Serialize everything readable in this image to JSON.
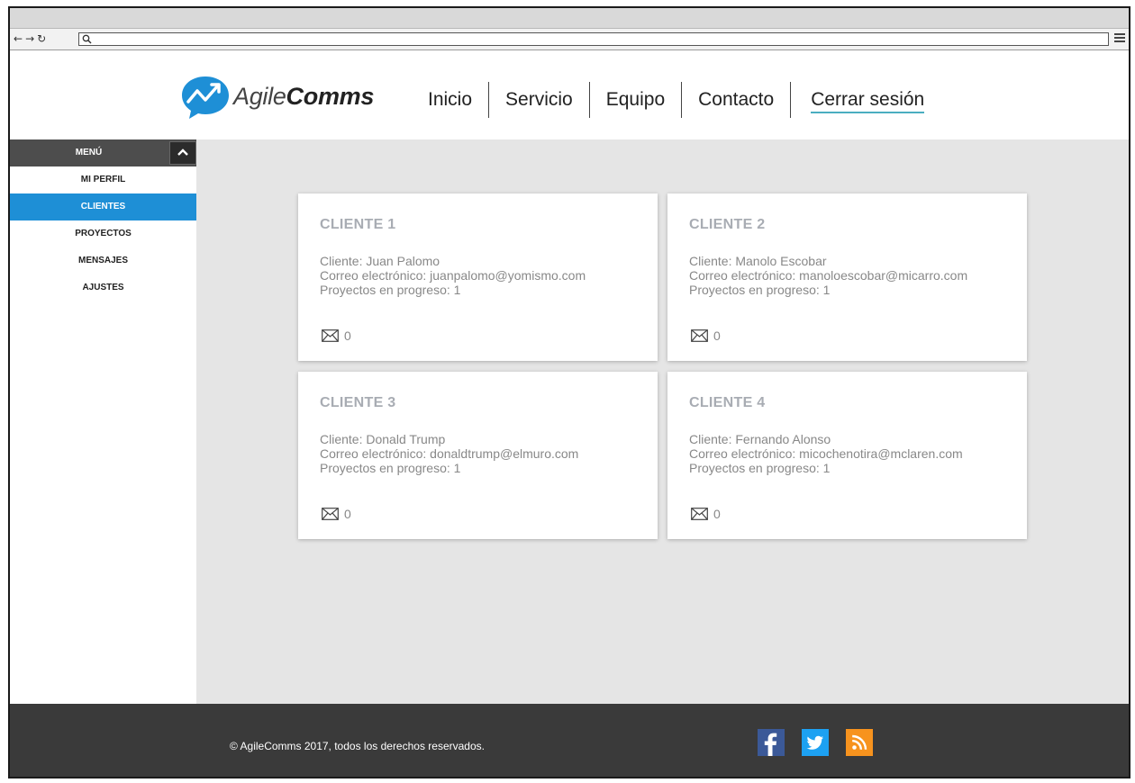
{
  "brand": {
    "light": "Agile",
    "bold": "Comms"
  },
  "nav": {
    "items": [
      "Inicio",
      "Servicio",
      "Equipo",
      "Contacto"
    ],
    "logout": "Cerrar sesión"
  },
  "sidebar": {
    "header": "MENÚ",
    "items": [
      {
        "label": "MI PERFIL",
        "active": false
      },
      {
        "label": "CLIENTES",
        "active": true
      },
      {
        "label": "PROYECTOS",
        "active": false
      },
      {
        "label": "MENSAJES",
        "active": false
      },
      {
        "label": "AJUSTES",
        "active": false
      }
    ]
  },
  "cards": [
    {
      "title": "CLIENTE 1",
      "client": "Cliente: Juan Palomo",
      "email": "Correo electrónico: juanpalomo@yomismo.com",
      "projects": "Proyectos en progreso: 1",
      "messages": "0"
    },
    {
      "title": "CLIENTE 2",
      "client": "Cliente: Manolo Escobar",
      "email": "Correo electrónico: manoloescobar@micarro.com",
      "projects": "Proyectos en progreso: 1",
      "messages": "0"
    },
    {
      "title": "CLIENTE 3",
      "client": "Cliente: Donald Trump",
      "email": "Correo electrónico: donaldtrump@elmuro.com",
      "projects": "Proyectos en progreso: 1",
      "messages": "0"
    },
    {
      "title": "CLIENTE 4",
      "client": "Cliente: Fernando Alonso",
      "email": "Correo electrónico: micochenotira@mclaren.com",
      "projects": "Proyectos en progreso: 1",
      "messages": "0"
    }
  ],
  "footer": {
    "copyright": "© AgileComms 2017, todos los derechos reservados.",
    "social": [
      "facebook-icon",
      "twitter-icon",
      "rss-icon"
    ]
  },
  "colors": {
    "accent": "#1e8fd6",
    "logout_underline": "#4aaec0",
    "footer_bg": "#3a3a3a",
    "facebook": "#3b5998",
    "twitter": "#1da1f2",
    "rss": "#f7931e"
  }
}
